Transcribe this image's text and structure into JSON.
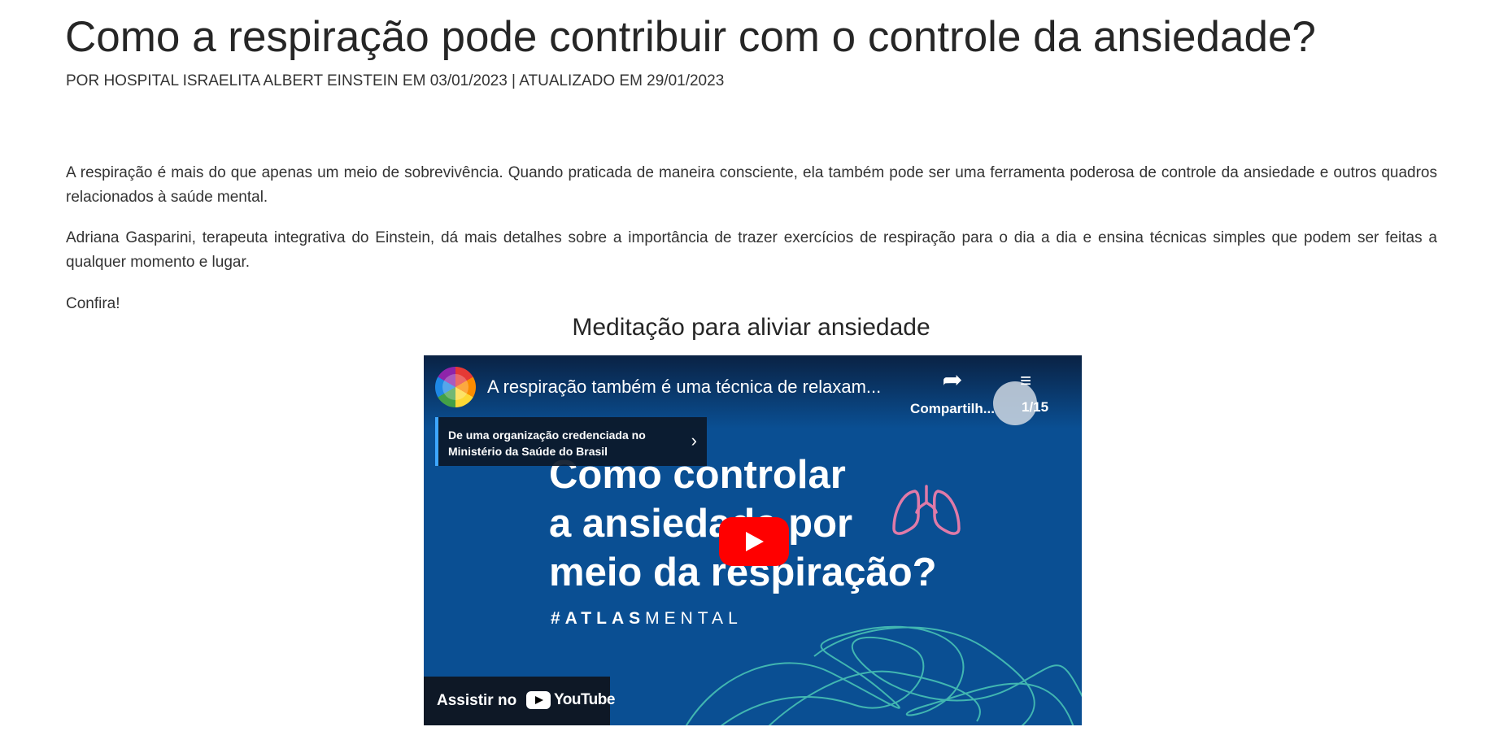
{
  "article": {
    "title": "Como a respiração pode contribuir com o controle da ansiedade?",
    "byline": "POR HOSPITAL ISRAELITA ALBERT EINSTEIN EM 03/01/2023 | ATUALIZADO EM 29/01/2023",
    "paragraphs": [
      "A respiração é mais do que apenas um meio de sobrevivência. Quando praticada de maneira consciente, ela também pode ser uma ferramenta poderosa de controle da ansiedade e outros quadros relacionados à saúde mental.",
      "Adriana Gasparini, terapeuta integrativa do Einstein, dá mais detalhes sobre a importância de trazer exercícios de respiração para o dia a dia e ensina técnicas simples que podem ser feitas a qualquer momento e lugar.",
      "Confira!"
    ]
  },
  "video": {
    "section_title": "Meditação para aliviar ansiedade",
    "heading": "A respiração também é uma técnica de relaxam...",
    "share_label": "Compartilh...",
    "counter": "1/15",
    "credential_text": "De uma organização credenciada no\nMinistério da Saúde do Brasil",
    "thumbnail_lines": [
      "Como controlar",
      "a ansiedade por",
      "meio da respiração?"
    ],
    "hashtag_bold": "#ATLAS",
    "hashtag_rest": "MENTAL",
    "watch_label": "Assistir no",
    "youtube_word": "YouTube",
    "icons": {
      "play": "play-icon",
      "share": "share-icon",
      "playlist": "playlist-icon",
      "chevron": "chevron-right-icon"
    },
    "colors": {
      "background": "#0a4f93",
      "play_button": "#ff0000",
      "accent_bar": "#3ea6ff",
      "lungs": "#e07aa8",
      "scribble": "#47c2b5"
    }
  }
}
